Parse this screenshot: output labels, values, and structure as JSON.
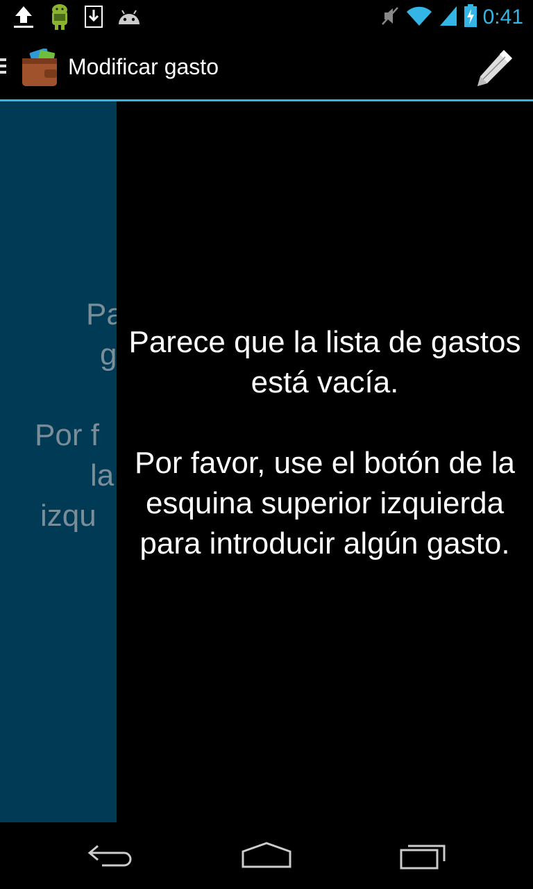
{
  "status_bar": {
    "time": "0:41",
    "left_icons": [
      "upload-icon",
      "android-debug-icon",
      "download-icon",
      "android-head-icon"
    ],
    "right_icons": [
      "mute-icon",
      "wifi-icon",
      "signal-icon",
      "battery-charging-icon"
    ],
    "accent_color": "#33b5e5"
  },
  "action_bar": {
    "title": "Modificar gasto",
    "app_icon": "wallet-icon",
    "action_icon": "pencil-icon"
  },
  "back_panel": {
    "color": "#003a55",
    "line1": "Pa",
    "line2": "g",
    "line3": "Por f",
    "line4": "la",
    "line5": "izqu"
  },
  "main": {
    "empty_title": "Parece que la lista de gastos está vacía.",
    "empty_hint": "Por favor, use el botón de la esquina superior izquierda para introducir algún gasto."
  },
  "nav_bar": {
    "icons": [
      "back-icon",
      "home-icon",
      "recent-apps-icon"
    ]
  }
}
